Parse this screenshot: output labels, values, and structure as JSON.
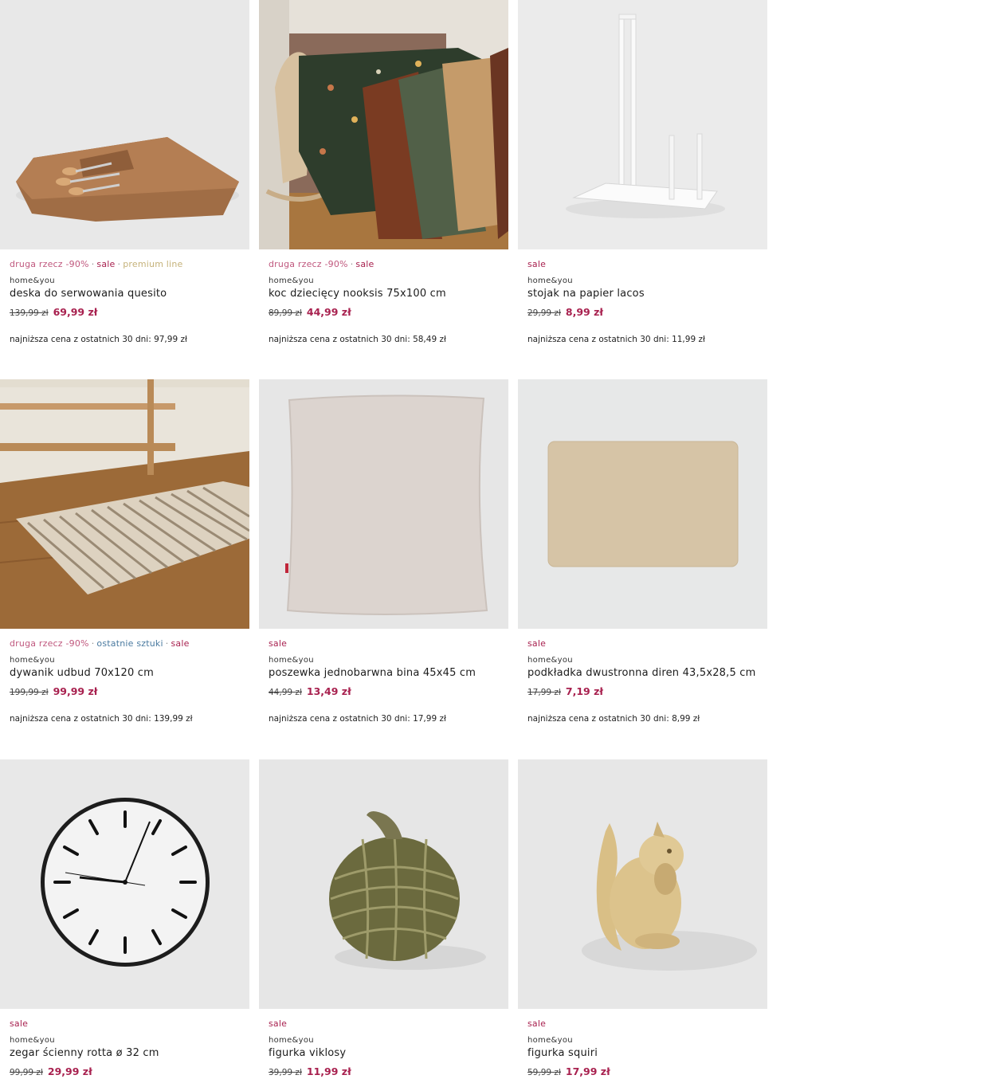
{
  "products": [
    {
      "tags": [
        {
          "text": "druga rzecz -90%",
          "style": "pink"
        },
        {
          "text": "sale",
          "style": "sale"
        },
        {
          "text": "premium line",
          "style": "gold"
        }
      ],
      "brand": "home&you",
      "name": "deska do serwowania quesito",
      "old_price": "139,99 zł",
      "new_price": "69,99 zł",
      "lowest": "najniższa cena z ostatnich 30 dni: 97,99 zł",
      "image": "serving-board-image"
    },
    {
      "tags": [
        {
          "text": "druga rzecz -90%",
          "style": "pink"
        },
        {
          "text": "sale",
          "style": "sale"
        }
      ],
      "brand": "home&you",
      "name": "koc dziecięcy nooksis 75x100 cm",
      "old_price": "89,99 zł",
      "new_price": "44,99 zł",
      "lowest": "najniższa cena z ostatnich 30 dni: 58,49 zł",
      "image": "blanket-image"
    },
    {
      "tags": [
        {
          "text": "sale",
          "style": "sale"
        }
      ],
      "brand": "home&you",
      "name": "stojak na papier lacos",
      "old_price": "29,99 zł",
      "new_price": "8,99 zł",
      "lowest": "najniższa cena z ostatnich 30 dni: 11,99 zł",
      "image": "paper-stand-image"
    },
    {
      "tags": [
        {
          "text": "druga rzecz -90%",
          "style": "pink"
        },
        {
          "text": "ostatnie sztuki",
          "style": "blue"
        },
        {
          "text": "sale",
          "style": "sale"
        }
      ],
      "brand": "home&you",
      "name": "dywanik udbud 70x120 cm",
      "old_price": "199,99 zł",
      "new_price": "99,99 zł",
      "lowest": "najniższa cena z ostatnich 30 dni: 139,99 zł",
      "image": "rug-image"
    },
    {
      "tags": [
        {
          "text": "sale",
          "style": "sale"
        }
      ],
      "brand": "home&you",
      "name": "poszewka jednobarwna bina 45x45 cm",
      "old_price": "44,99 zł",
      "new_price": "13,49 zł",
      "lowest": "najniższa cena z ostatnich 30 dni: 17,99 zł",
      "image": "pillowcase-image"
    },
    {
      "tags": [
        {
          "text": "sale",
          "style": "sale"
        }
      ],
      "brand": "home&you",
      "name": "podkładka dwustronna diren 43,5x28,5 cm",
      "old_price": "17,99 zł",
      "new_price": "7,19 zł",
      "lowest": "najniższa cena z ostatnich 30 dni: 8,99 zł",
      "image": "placemat-image"
    },
    {
      "tags": [
        {
          "text": "sale",
          "style": "sale"
        }
      ],
      "brand": "home&you",
      "name": "zegar ścienny rotta ø 32 cm",
      "old_price": "99,99 zł",
      "new_price": "29,99 zł",
      "lowest": "",
      "image": "wall-clock-image"
    },
    {
      "tags": [
        {
          "text": "sale",
          "style": "sale"
        }
      ],
      "brand": "home&you",
      "name": "figurka viklosy",
      "old_price": "39,99 zł",
      "new_price": "11,99 zł",
      "lowest": "",
      "image": "pumpkin-figurine-image"
    },
    {
      "tags": [
        {
          "text": "sale",
          "style": "sale"
        }
      ],
      "brand": "home&you",
      "name": "figurka squiri",
      "old_price": "59,99 zł",
      "new_price": "17,99 zł",
      "lowest": "",
      "image": "squirrel-figurine-image"
    }
  ],
  "colors": {
    "sale": "#a8214f",
    "pink": "#c0587e",
    "gold": "#c5b27a",
    "blue": "#4a7aa0"
  }
}
